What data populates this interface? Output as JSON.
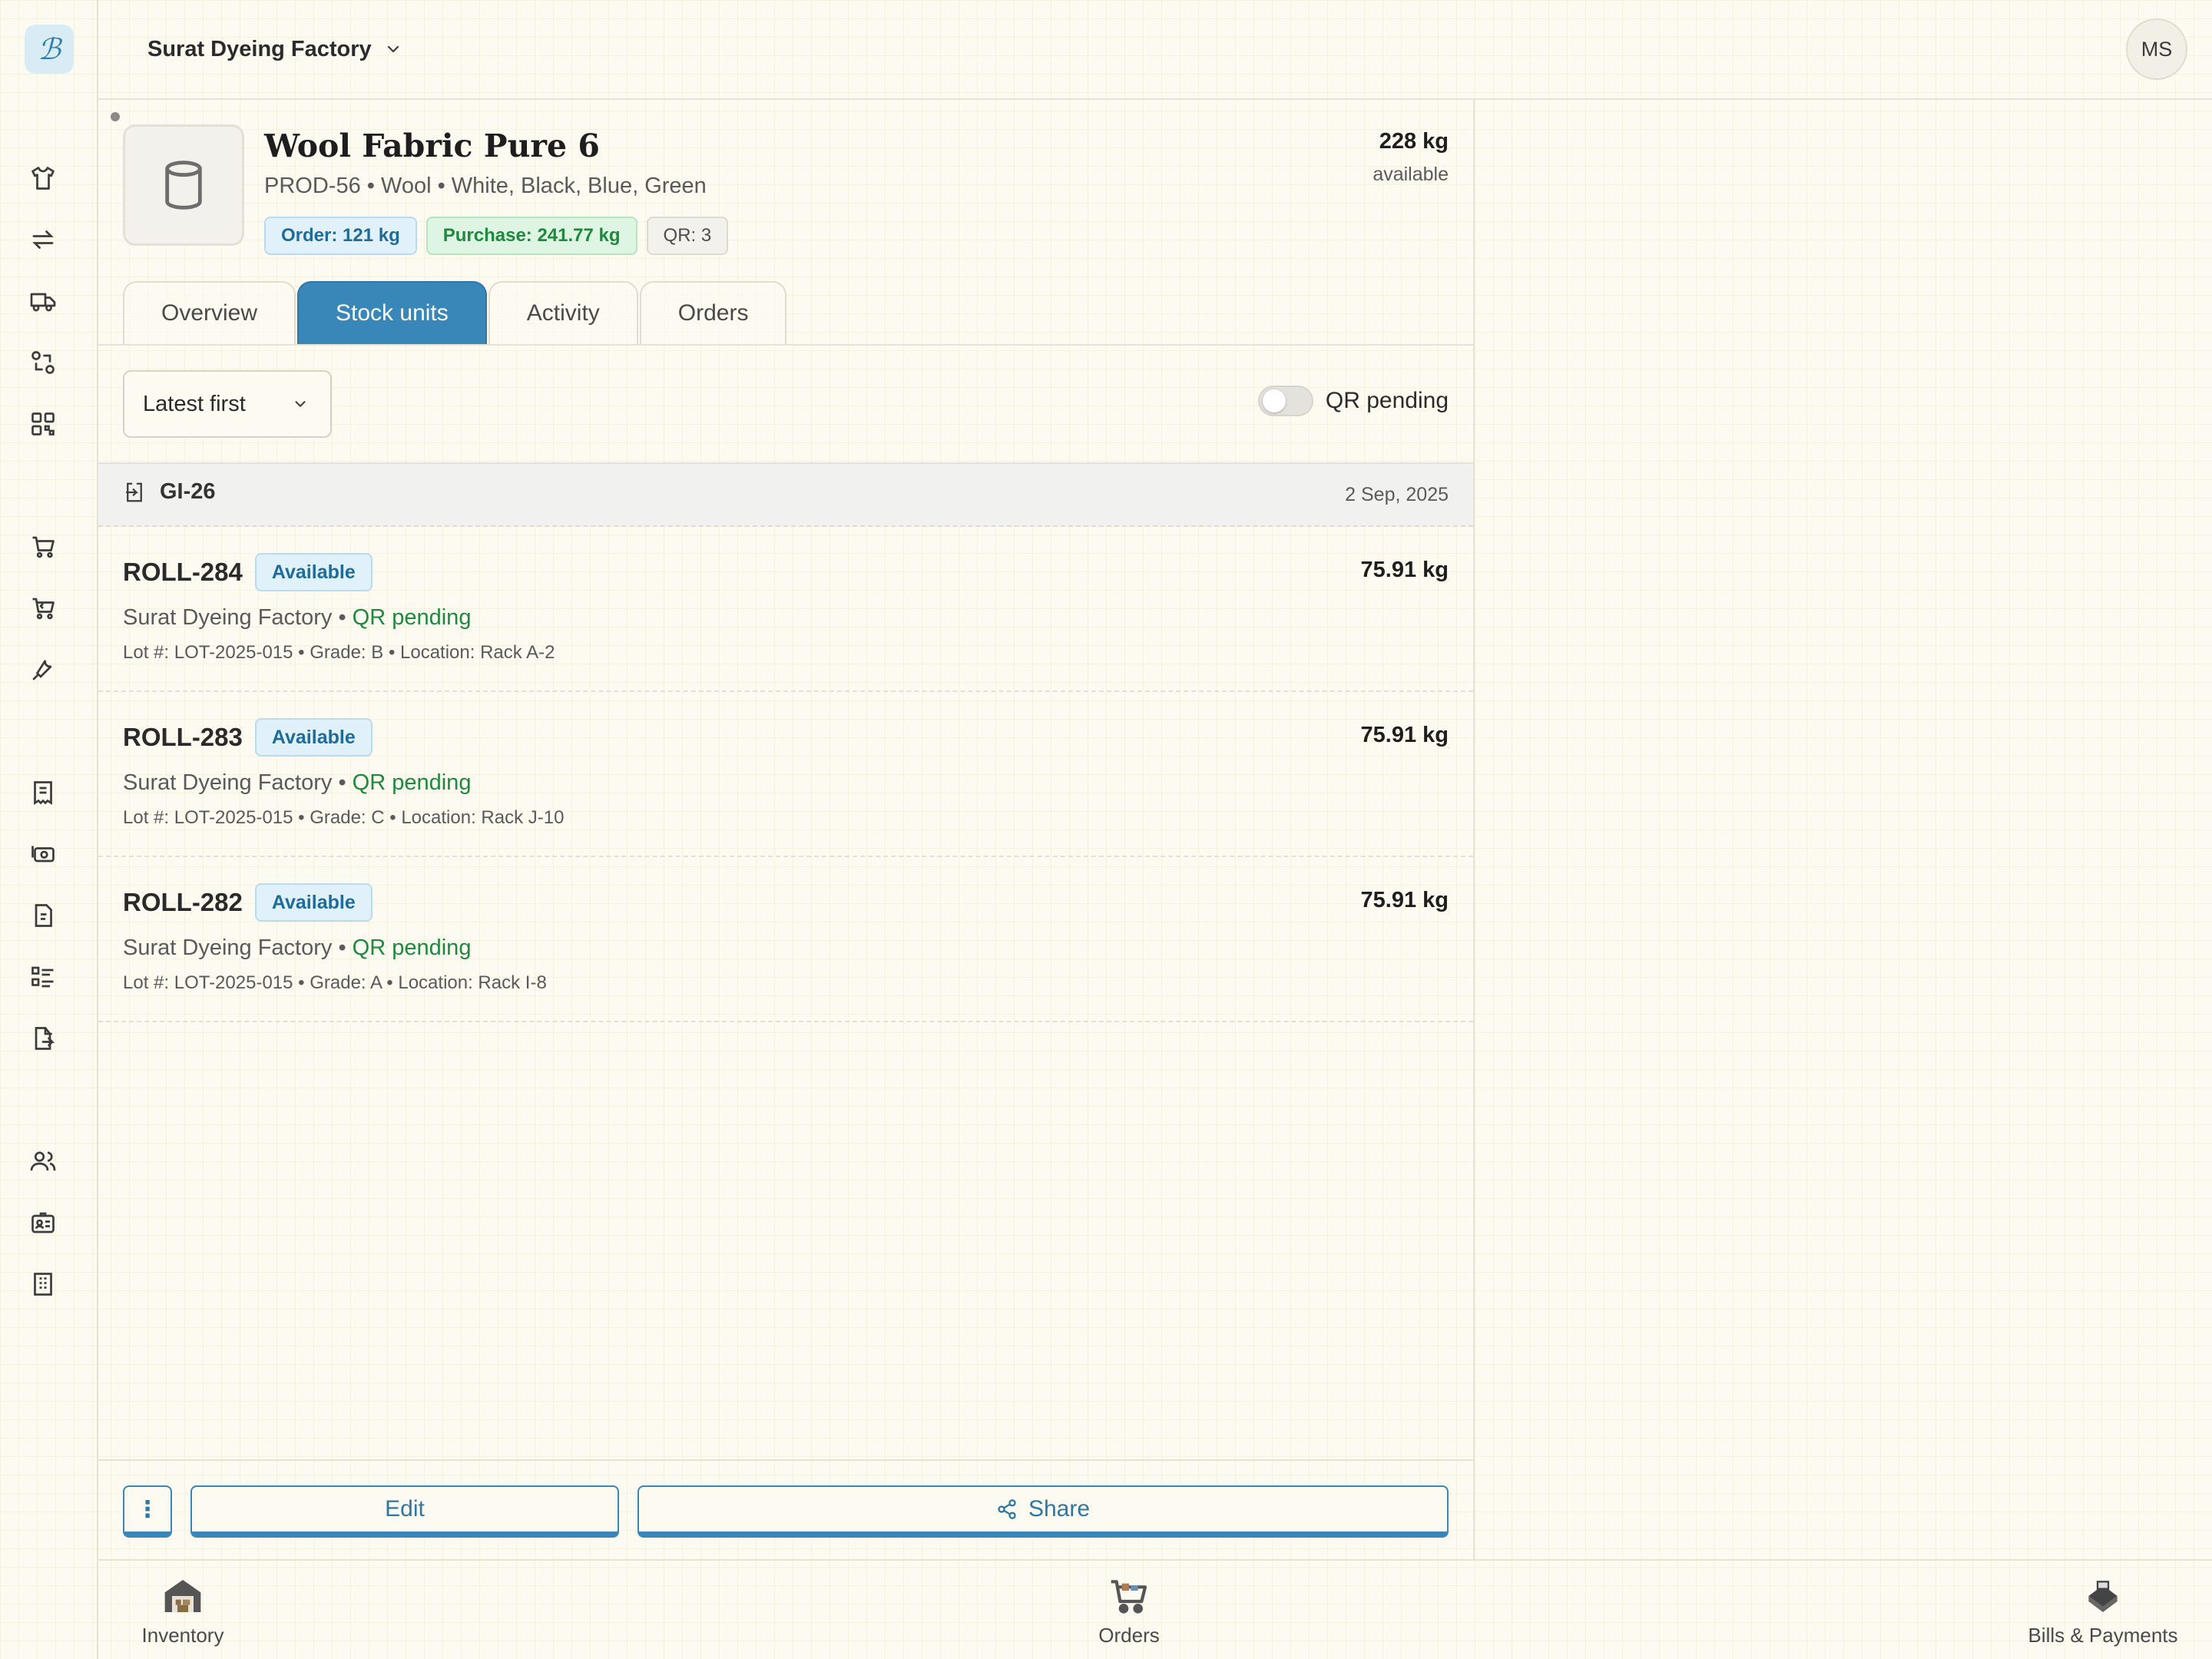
{
  "header": {
    "company": "Surat Dyeing Factory",
    "avatar_initials": "MS"
  },
  "product": {
    "name": "Wool Fabric Pure 6",
    "subtitle": "PROD-56 • Wool • White, Black, Blue, Green",
    "badges": {
      "order": "Order: 121 kg",
      "purchase": "Purchase: 241.77 kg",
      "qr": "QR: 3"
    },
    "available_qty": "228 kg",
    "available_label": "available"
  },
  "tabs": [
    "Overview",
    "Stock units",
    "Activity",
    "Orders"
  ],
  "active_tab": "Stock units",
  "filters": {
    "sort_value": "Latest first",
    "toggle_label": "QR pending"
  },
  "group": {
    "id": "GI-26",
    "date": "2 Sep, 2025"
  },
  "units": [
    {
      "name": "ROLL-284",
      "status": "Available",
      "factory": "Surat Dyeing Factory",
      "sep": " • ",
      "qr_status": "QR pending",
      "lot": "Lot #: LOT-2025-015 • Grade: B • Location: Rack A-2",
      "weight": "75.91 kg"
    },
    {
      "name": "ROLL-283",
      "status": "Available",
      "factory": "Surat Dyeing Factory",
      "sep": " • ",
      "qr_status": "QR pending",
      "lot": "Lot #: LOT-2025-015 • Grade: C • Location: Rack J-10",
      "weight": "75.91 kg"
    },
    {
      "name": "ROLL-282",
      "status": "Available",
      "factory": "Surat Dyeing Factory",
      "sep": " • ",
      "qr_status": "QR pending",
      "lot": "Lot #: LOT-2025-015 • Grade: A • Location: Rack I-8",
      "weight": "75.91 kg"
    }
  ],
  "actions": {
    "more": "⋮",
    "edit": "Edit",
    "share": "Share"
  },
  "bottom_nav": [
    "Inventory",
    "Orders",
    "Bills & Payments"
  ],
  "colors": {
    "accent": "#3887b8",
    "green": "#1f8a3d",
    "background": "#fdfaf1"
  },
  "sidebar_icons": [
    "shirt-icon",
    "transfer-icon",
    "truck-icon",
    "exchange-icon",
    "qr-code-icon",
    "cart-icon",
    "cart-return-icon",
    "tools-icon",
    "receipt-icon",
    "cash-icon",
    "invoice-icon",
    "checklist-icon",
    "document-export-icon",
    "users-icon",
    "id-card-icon",
    "building-icon"
  ]
}
